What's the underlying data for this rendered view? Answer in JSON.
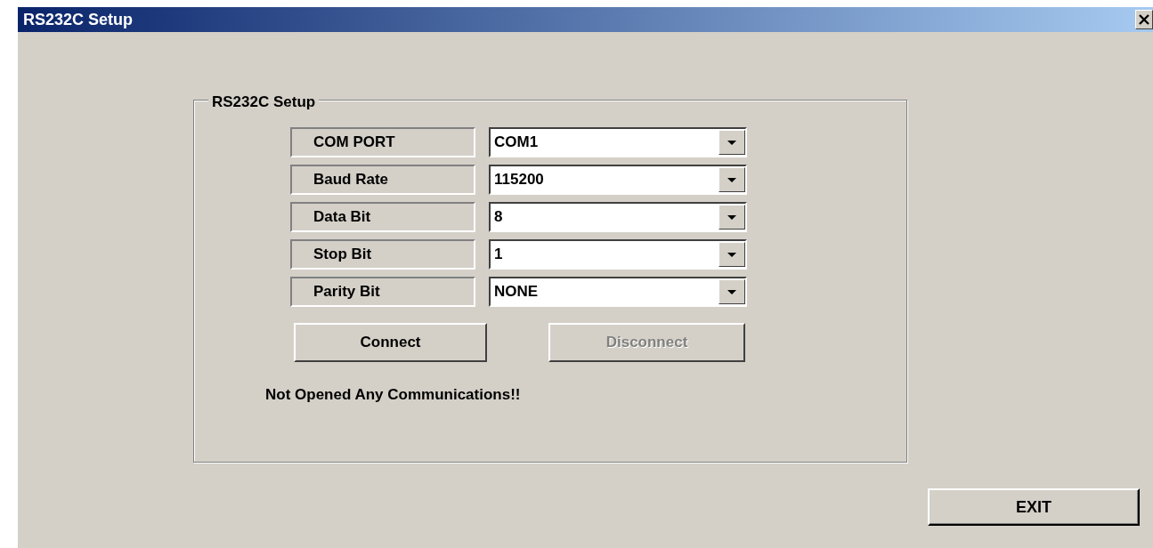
{
  "window": {
    "title": "RS232C Setup"
  },
  "group": {
    "title": "RS232C Setup",
    "fields": [
      {
        "label": "COM PORT",
        "value": "COM1"
      },
      {
        "label": "Baud Rate",
        "value": "115200"
      },
      {
        "label": "Data Bit",
        "value": "8"
      },
      {
        "label": "Stop Bit",
        "value": "1"
      },
      {
        "label": "Parity Bit",
        "value": "NONE"
      }
    ],
    "buttons": [
      {
        "label": "Connect",
        "disabled": false
      },
      {
        "label": "Disconnect",
        "disabled": true
      }
    ],
    "status": "Not Opened Any Communications!!"
  },
  "exit_button": {
    "label": "EXIT"
  }
}
